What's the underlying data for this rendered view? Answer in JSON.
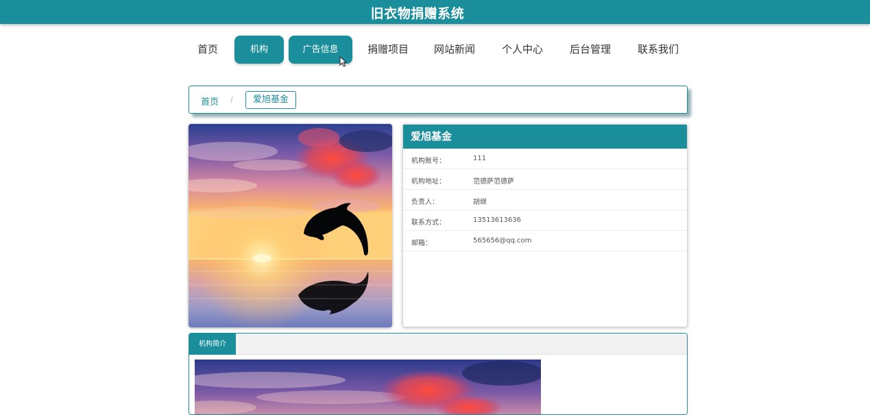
{
  "header": {
    "site_title": "旧衣物捐赠系统"
  },
  "nav": {
    "items": [
      {
        "label": "首页",
        "active": false
      },
      {
        "label": "机构",
        "active": true
      },
      {
        "label": "广告信息",
        "active": true
      },
      {
        "label": "捐赠项目",
        "active": false
      },
      {
        "label": "网站新闻",
        "active": false
      },
      {
        "label": "个人中心",
        "active": false
      },
      {
        "label": "后台管理",
        "active": false
      },
      {
        "label": "联系我们",
        "active": false
      }
    ]
  },
  "breadcrumb": {
    "home": "首页",
    "separator": "/",
    "current": "爱旭基金"
  },
  "org": {
    "name": "爱旭基金",
    "fields": [
      {
        "label": "机构账号：",
        "value": "111"
      },
      {
        "label": "机构地址：",
        "value": "范德萨范德萨"
      },
      {
        "label": "负责人：",
        "value": "胡继"
      },
      {
        "label": "联系方式：",
        "value": "13513613636"
      },
      {
        "label": "邮箱：",
        "value": "565656@qq.com"
      }
    ]
  },
  "intro": {
    "tab_label": "机构简介"
  },
  "image": {
    "subject": "dolphin-sunset"
  },
  "colors": {
    "primary": "#1b8e9c",
    "text": "#333333"
  }
}
